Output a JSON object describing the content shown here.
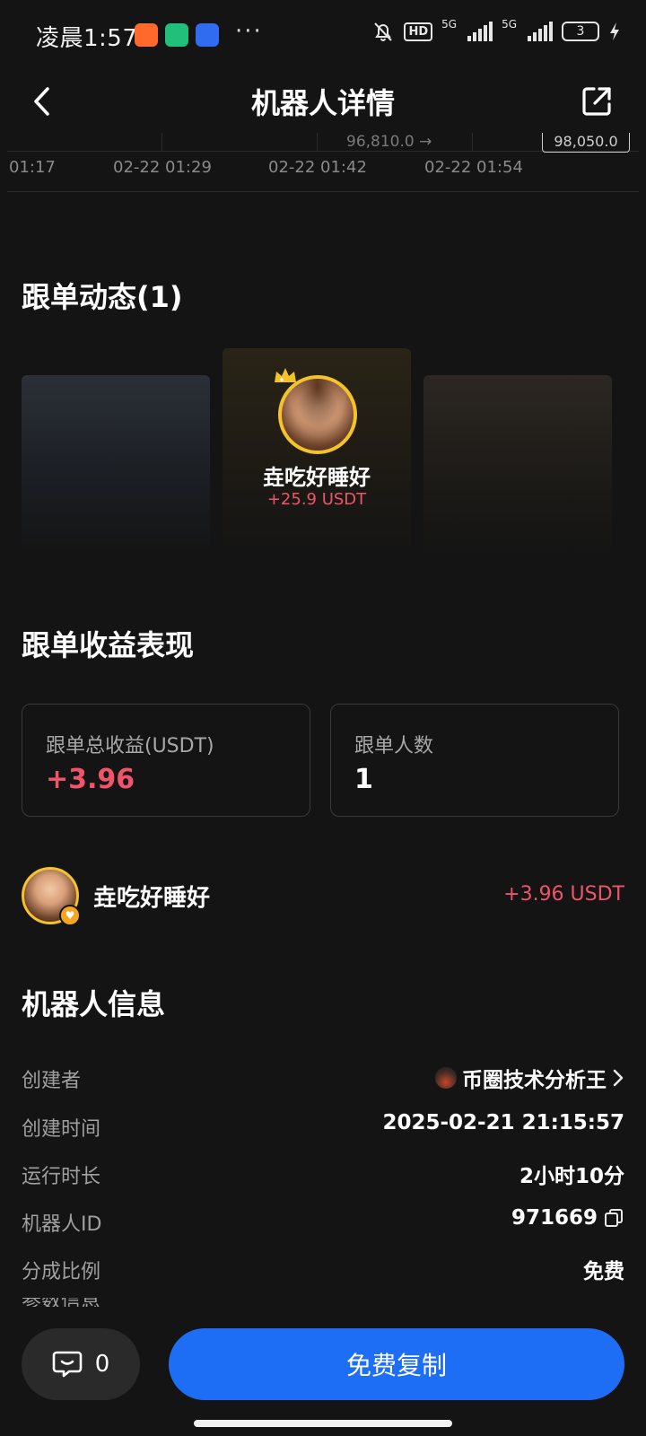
{
  "status_bar": {
    "time": "凌晨1:57",
    "dots": "···",
    "hd": "HD",
    "net1": "5G",
    "net2": "5G",
    "battery": "3"
  },
  "header": {
    "title": "机器人详情"
  },
  "chart_strip": {
    "price_label": "96,810.0 →",
    "price_tag": "98,050.0",
    "ticks": [
      "01:17",
      "02-22 01:29",
      "02-22 01:42",
      "02-22 01:54"
    ]
  },
  "follow_activity": {
    "title": "跟单动态(1)",
    "top_follower": {
      "name": "垚吃好睡好",
      "profit": "+25.9 USDT"
    }
  },
  "follow_performance": {
    "title": "跟单收益表现",
    "total_profit_label": "跟单总收益(USDT)",
    "total_profit_value": "+3.96",
    "followers_label": "跟单人数",
    "followers_value": "1"
  },
  "follower": {
    "name": "垚吃好睡好",
    "profit": "+3.96 USDT"
  },
  "robot_info": {
    "title": "机器人信息",
    "creator_label": "创建者",
    "creator_value": "币圈技术分析王",
    "created_label": "创建时间",
    "created_value": "2025-02-21 21:15:57",
    "runtime_label": "运行时长",
    "runtime_value": "2小时10分",
    "id_label": "机器人ID",
    "id_value": "971669",
    "share_label": "分成比例",
    "share_value": "免费",
    "cut_label": "参数信息"
  },
  "bottom_bar": {
    "comment_count": "0",
    "copy_button": "免费复制"
  },
  "colors": {
    "background": "#141414",
    "profit_red": "#f0546a",
    "primary_blue": "#1e6ef5",
    "gold": "#f4c22b"
  }
}
